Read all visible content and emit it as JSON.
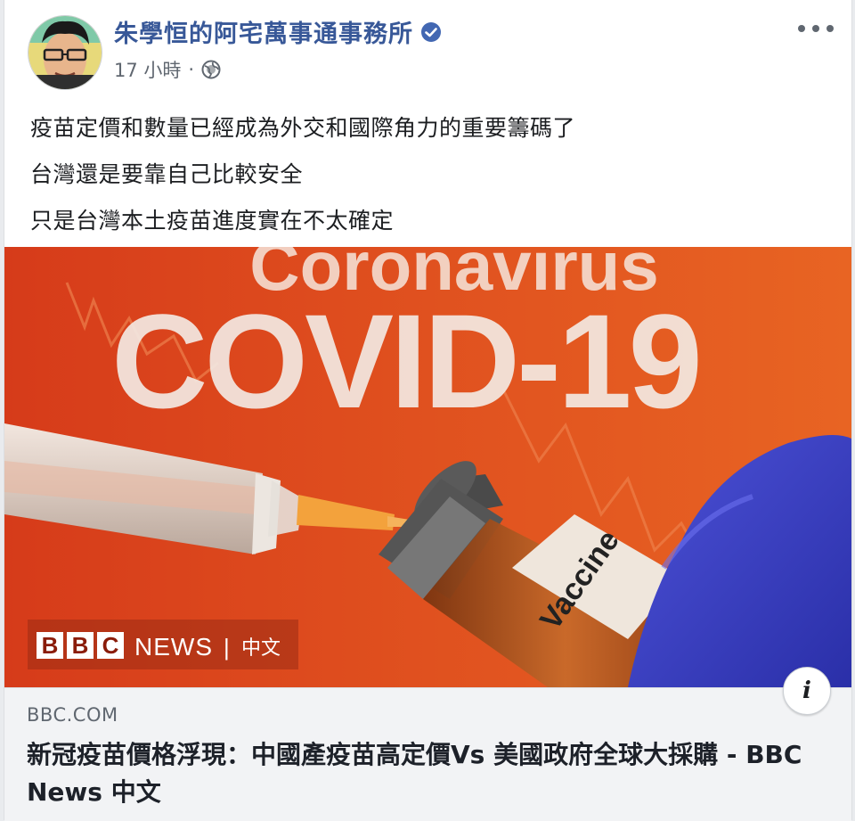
{
  "post": {
    "page_name": "朱學恒的阿宅萬事通事務所",
    "timestamp": "17 小時",
    "separator": "·",
    "privacy_icon": "globe-icon",
    "verified_icon": "verified-badge-icon",
    "more_icon": "more-options-icon",
    "text_lines": [
      "疫苗定價和數量已經成為外交和國際角力的重要籌碼了",
      "台灣還是要靠自己比較安全",
      "只是台灣本土疫苗進度實在不太確定"
    ]
  },
  "media": {
    "headline_top": "Coronavirus",
    "headline_main": "COVID-19",
    "vial_label": "Vaccine",
    "logo_letters": [
      "B",
      "B",
      "C"
    ],
    "logo_news": "NEWS",
    "logo_divider": "|",
    "logo_lang": "中文"
  },
  "link": {
    "domain": "BBC.COM",
    "title": "新冠疫苗價格浮現：中國產疫苗高定價Vs 美國政府全球大採購 - BBC News 中文",
    "info_label": "i"
  },
  "colors": {
    "name_blue": "#385898",
    "verified_blue": "#4267b2",
    "meta_gray": "#606770",
    "image_red": "#d9441c",
    "link_bg": "#f2f3f5"
  }
}
